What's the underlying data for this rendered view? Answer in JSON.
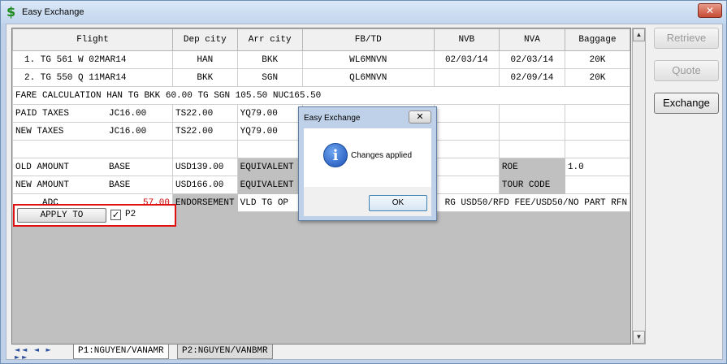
{
  "window": {
    "title": "Easy Exchange",
    "close_glyph": "✕",
    "icon": "dollar-icon"
  },
  "grid": {
    "headers": [
      "Flight",
      "Dep city",
      "Arr city",
      "FB/TD",
      "NVB",
      "NVA",
      "Baggage"
    ],
    "flights": [
      {
        "flight": "1. TG  561 W  02MAR14",
        "dep": "HAN",
        "arr": "BKK",
        "fb": "WL6MNVN",
        "nvb": "02/03/14",
        "nva": "02/03/14",
        "bag": "20K"
      },
      {
        "flight": "2. TG  550 Q  11MAR14",
        "dep": "BKK",
        "arr": "SGN",
        "fb": "QL6MNVN",
        "nvb": "",
        "nva": "02/09/14",
        "bag": "20K"
      }
    ],
    "fare_calc_label": "FARE CALCULATION",
    "fare_calc_value": "HAN TG BKK 60.00 TG SGN 105.50 NUC165.50",
    "paid_taxes_label": "PAID TAXES",
    "paid_taxes": [
      "JC16.00",
      "TS22.00",
      "YQ79.00"
    ],
    "new_taxes_label": "NEW TAXES",
    "new_taxes": [
      "JC16.00",
      "TS22.00",
      "YQ79.00"
    ],
    "old_amount_label": "OLD AMOUNT",
    "old_amount_base": "BASE",
    "old_amount_value": "USD139.00",
    "old_amount_equiv": "EQUIVALENT",
    "roe_label": "ROE",
    "roe_value": "1.0",
    "new_amount_label": "NEW AMOUNT",
    "new_amount_base": "BASE",
    "new_amount_value": "USD166.00",
    "new_amount_equiv": "EQUIVALENT",
    "tour_code_label": "TOUR CODE",
    "adc_label": "ADC",
    "adc_value": "57.00",
    "endorsement_label": "ENDORSEMENT",
    "endorsement_value": "VLD  TG OP",
    "endorsement_value_right": "RG USD50/RFD FEE/USD50/NO PART RFN",
    "apply_to_label": "APPLY TO",
    "apply_checked": "✓",
    "apply_passenger": "P2"
  },
  "tabs": [
    {
      "label": "P1:NGUYEN/VANAMR",
      "active": true
    },
    {
      "label": "P2:NGUYEN/VANBMR",
      "active": false
    }
  ],
  "nav_glyphs": "◄◄ ◄ ► ►►",
  "buttons": {
    "retrieve": "Retrieve",
    "quote": "Quote",
    "exchange": "Exchange"
  },
  "dialog": {
    "title": "Easy Exchange",
    "close_glyph": "✕",
    "message": "Changes applied",
    "ok": "OK",
    "icon_glyph": "i"
  },
  "colors": {
    "accent_red": "#e01010",
    "adc_red": "#cc0000"
  }
}
